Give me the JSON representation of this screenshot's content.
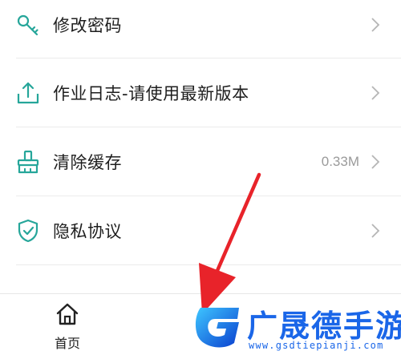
{
  "menu": {
    "items": [
      {
        "label": "修改密码",
        "icon": "key-icon",
        "value": ""
      },
      {
        "label": "作业日志-请使用最新版本",
        "icon": "upload-icon",
        "value": ""
      },
      {
        "label": "清除缓存",
        "icon": "brush-icon",
        "value": "0.33M"
      },
      {
        "label": "隐私协议",
        "icon": "shield-check-icon",
        "value": ""
      },
      {
        "label": "",
        "icon": "list-icon",
        "value": ""
      }
    ]
  },
  "tabbar": {
    "tabs": [
      {
        "label": "首页",
        "icon": "home-icon"
      },
      {
        "label": "",
        "icon": ""
      }
    ]
  },
  "watermark": {
    "title": "广晟德手游",
    "url": "www.gsdtiepianji.com"
  },
  "colors": {
    "accent": "#26a69a",
    "arrow": "#e8232a",
    "watermark": "#1a66e8"
  }
}
